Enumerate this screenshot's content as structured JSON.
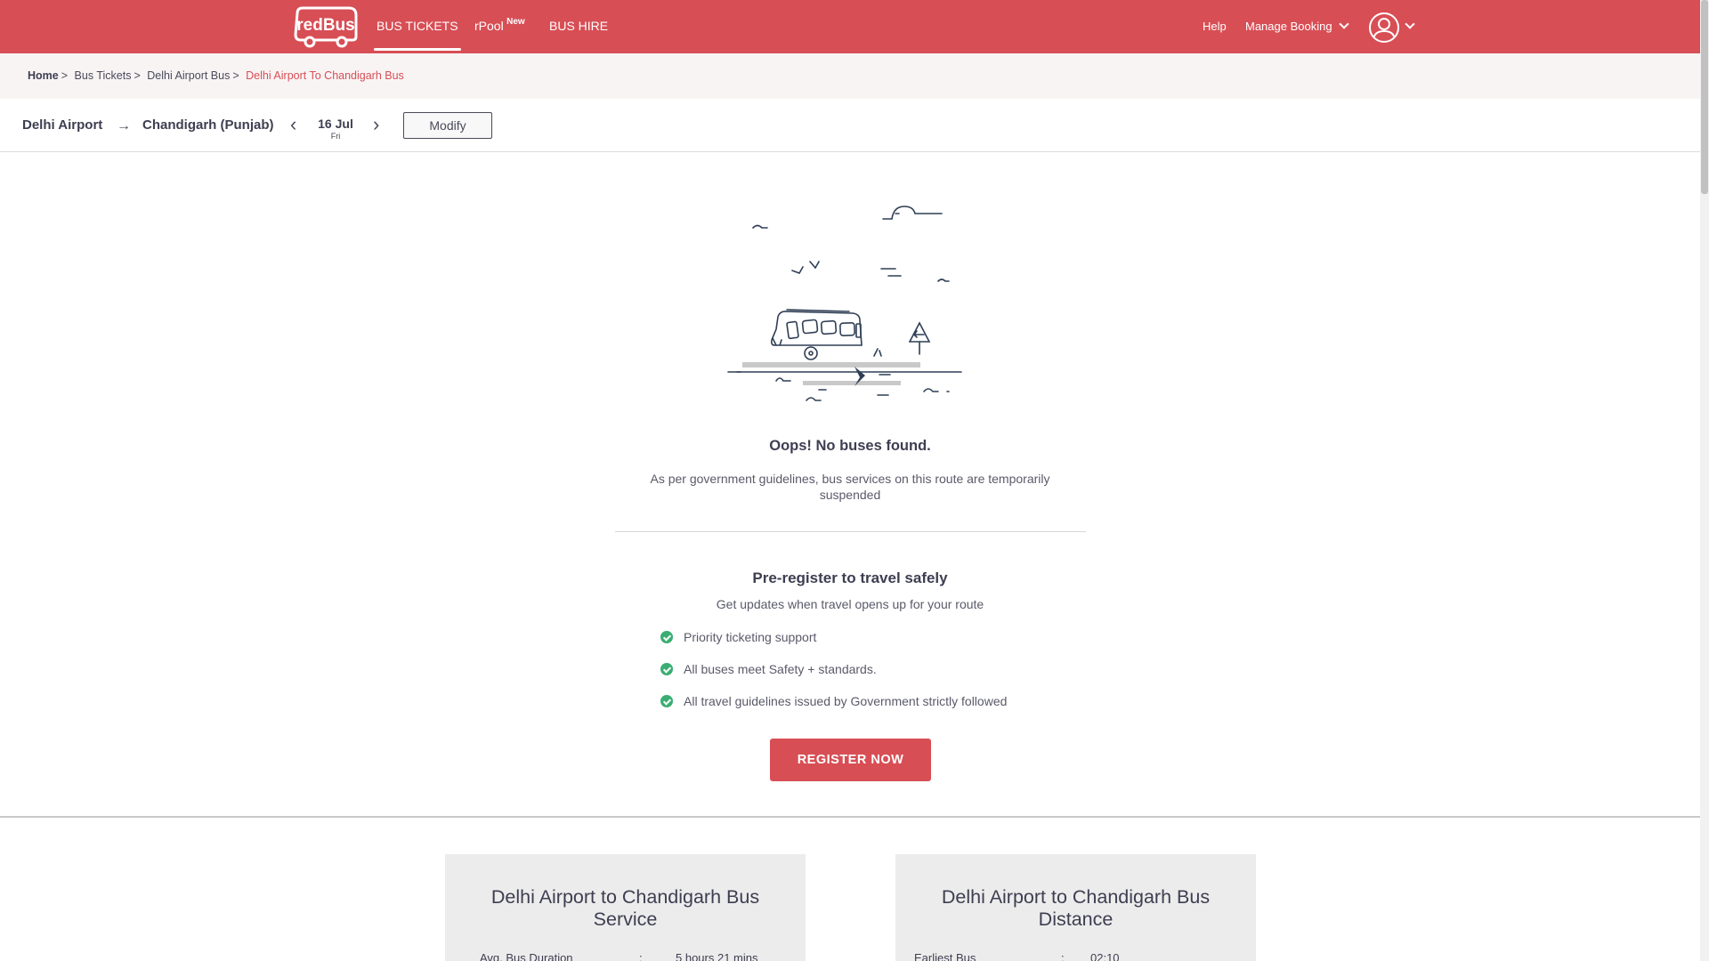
{
  "header": {
    "logo_text": "redBus",
    "nav": [
      {
        "label": "BUS TICKETS"
      },
      {
        "label": "rPool",
        "badge": "New"
      },
      {
        "label": "BUS HIRE"
      }
    ],
    "help_label": "Help",
    "manage_booking_label": "Manage Booking",
    "icons": [
      "profile-icon",
      "chevron-down-icon"
    ]
  },
  "breadcrumb": {
    "home": "Home",
    "bus_tickets": "Bus Tickets",
    "route_city": "Delhi Airport Bus",
    "current": "Delhi Airport To Chandigarh Bus",
    "separator": ">"
  },
  "search": {
    "source": "Delhi Airport",
    "destination": "Chandigarh (Punjab)",
    "date": "16 Jul",
    "weekday": "Fri",
    "modify_label": "Modify"
  },
  "empty_state": {
    "title": "Oops! No buses found.",
    "message": "As per government guidelines, bus services on this route are temporarily suspended"
  },
  "preregister": {
    "title": "Pre-register to travel safely",
    "subtitle": "Get updates when travel opens up for your route",
    "benefits": [
      "Priority ticketing support",
      "All buses meet Safety + standards.",
      "All travel guidelines issued by Government strictly followed"
    ],
    "cta_label": "REGISTER NOW"
  },
  "info_cards": [
    {
      "title": "Delhi Airport to Chandigarh Bus Service",
      "row_label": "Avg. Bus Duration",
      "row_sep": ":",
      "row_value": "5 hours 21 mins"
    },
    {
      "title": "Delhi Airport to Chandigarh Bus Distance",
      "row_label": "Earliest Bus",
      "row_sep": ":",
      "row_value": "02:10"
    }
  ],
  "colors": {
    "brand": "#d84e55",
    "success": "#3aae72",
    "text": "#3e3e52"
  }
}
